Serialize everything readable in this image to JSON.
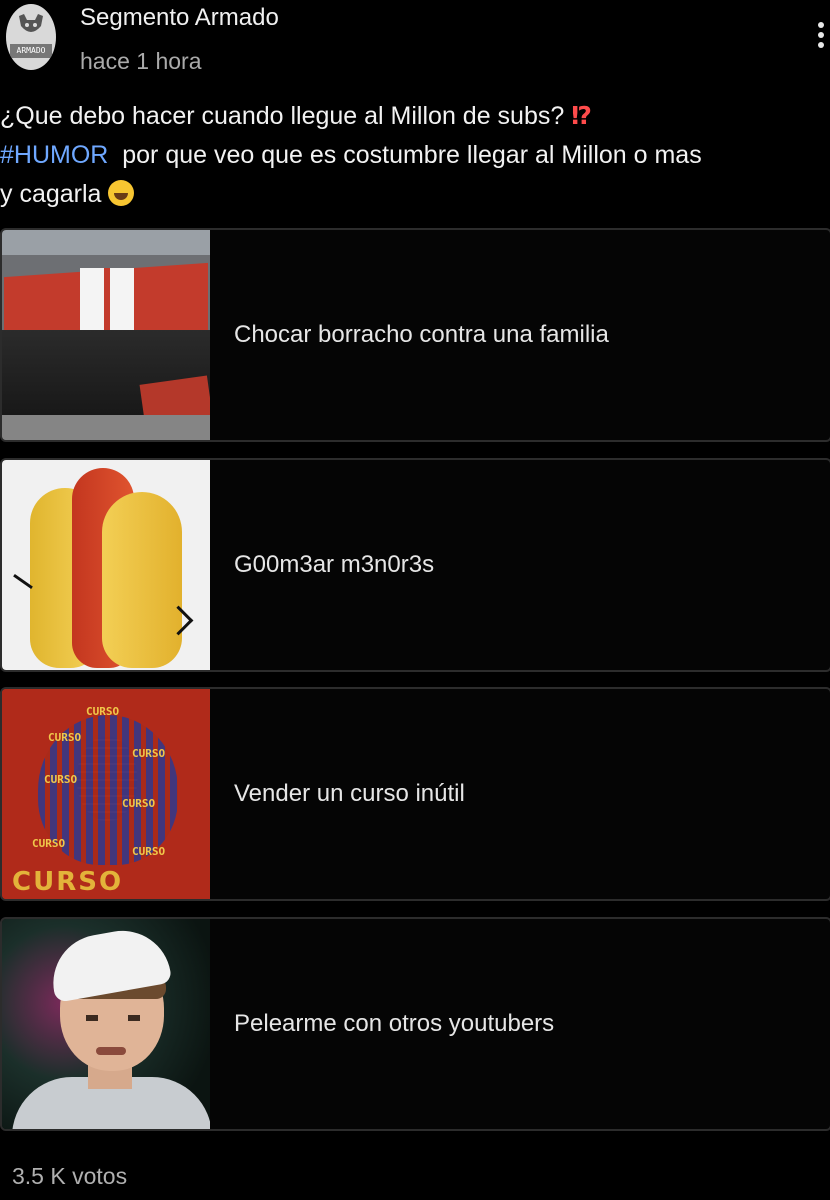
{
  "header": {
    "author": "Segmento Armado",
    "time": "hace 1 hora",
    "avatar_ribbon": "ARMADO"
  },
  "post": {
    "line1": "¿Que debo hacer cuando llegue al Millon de subs? ",
    "line1_emoji": "⁉",
    "hashtag": "#HUMOR",
    "line2_rest": "  por que veo que es costumbre llegar al Millon o mas",
    "line3": "y cagarla "
  },
  "poll": {
    "options": [
      {
        "label": "Chocar borracho contra una familia",
        "thumb": "wrecked-car-image"
      },
      {
        "label": "G00m3ar m3n0r3s",
        "thumb": "sausage-image"
      },
      {
        "label": "Vender un curso inútil",
        "thumb": "curso-mosaic-image"
      },
      {
        "label": "Pelearme con otros youtubers",
        "thumb": "youtuber-image"
      }
    ],
    "curso_small": "CURSO",
    "curso_big": "CURSO",
    "votes": "3.5 K votos"
  }
}
